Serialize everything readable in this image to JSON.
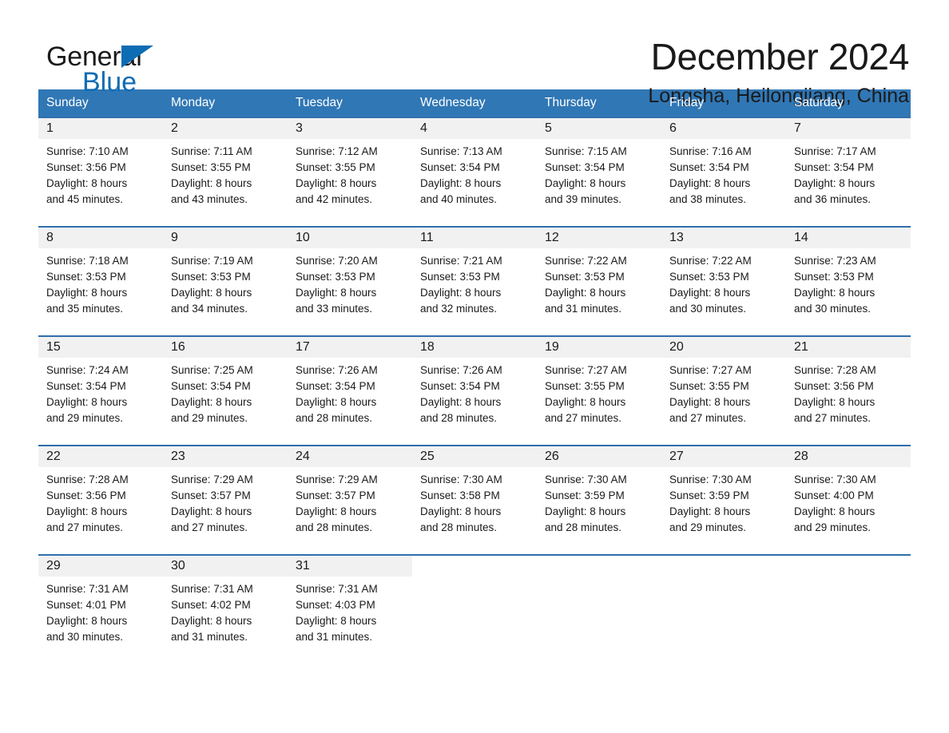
{
  "brand": {
    "name_part1": "General",
    "name_part2": "Blue",
    "triangle_color": "#0d6cb4"
  },
  "header": {
    "month_title": "December 2024",
    "location": "Longsha, Heilongjiang, China"
  },
  "calendar": {
    "accent_color": "#3077b5",
    "row_border_color": "#2f6fad",
    "daynum_band_color": "#f1f1f1",
    "weekday_headers": [
      "Sunday",
      "Monday",
      "Tuesday",
      "Wednesday",
      "Thursday",
      "Friday",
      "Saturday"
    ],
    "weeks": [
      [
        {
          "day": "1",
          "sunrise": "Sunrise: 7:10 AM",
          "sunset": "Sunset: 3:56 PM",
          "daylight_line1": "Daylight: 8 hours",
          "daylight_line2": "and 45 minutes."
        },
        {
          "day": "2",
          "sunrise": "Sunrise: 7:11 AM",
          "sunset": "Sunset: 3:55 PM",
          "daylight_line1": "Daylight: 8 hours",
          "daylight_line2": "and 43 minutes."
        },
        {
          "day": "3",
          "sunrise": "Sunrise: 7:12 AM",
          "sunset": "Sunset: 3:55 PM",
          "daylight_line1": "Daylight: 8 hours",
          "daylight_line2": "and 42 minutes."
        },
        {
          "day": "4",
          "sunrise": "Sunrise: 7:13 AM",
          "sunset": "Sunset: 3:54 PM",
          "daylight_line1": "Daylight: 8 hours",
          "daylight_line2": "and 40 minutes."
        },
        {
          "day": "5",
          "sunrise": "Sunrise: 7:15 AM",
          "sunset": "Sunset: 3:54 PM",
          "daylight_line1": "Daylight: 8 hours",
          "daylight_line2": "and 39 minutes."
        },
        {
          "day": "6",
          "sunrise": "Sunrise: 7:16 AM",
          "sunset": "Sunset: 3:54 PM",
          "daylight_line1": "Daylight: 8 hours",
          "daylight_line2": "and 38 minutes."
        },
        {
          "day": "7",
          "sunrise": "Sunrise: 7:17 AM",
          "sunset": "Sunset: 3:54 PM",
          "daylight_line1": "Daylight: 8 hours",
          "daylight_line2": "and 36 minutes."
        }
      ],
      [
        {
          "day": "8",
          "sunrise": "Sunrise: 7:18 AM",
          "sunset": "Sunset: 3:53 PM",
          "daylight_line1": "Daylight: 8 hours",
          "daylight_line2": "and 35 minutes."
        },
        {
          "day": "9",
          "sunrise": "Sunrise: 7:19 AM",
          "sunset": "Sunset: 3:53 PM",
          "daylight_line1": "Daylight: 8 hours",
          "daylight_line2": "and 34 minutes."
        },
        {
          "day": "10",
          "sunrise": "Sunrise: 7:20 AM",
          "sunset": "Sunset: 3:53 PM",
          "daylight_line1": "Daylight: 8 hours",
          "daylight_line2": "and 33 minutes."
        },
        {
          "day": "11",
          "sunrise": "Sunrise: 7:21 AM",
          "sunset": "Sunset: 3:53 PM",
          "daylight_line1": "Daylight: 8 hours",
          "daylight_line2": "and 32 minutes."
        },
        {
          "day": "12",
          "sunrise": "Sunrise: 7:22 AM",
          "sunset": "Sunset: 3:53 PM",
          "daylight_line1": "Daylight: 8 hours",
          "daylight_line2": "and 31 minutes."
        },
        {
          "day": "13",
          "sunrise": "Sunrise: 7:22 AM",
          "sunset": "Sunset: 3:53 PM",
          "daylight_line1": "Daylight: 8 hours",
          "daylight_line2": "and 30 minutes."
        },
        {
          "day": "14",
          "sunrise": "Sunrise: 7:23 AM",
          "sunset": "Sunset: 3:53 PM",
          "daylight_line1": "Daylight: 8 hours",
          "daylight_line2": "and 30 minutes."
        }
      ],
      [
        {
          "day": "15",
          "sunrise": "Sunrise: 7:24 AM",
          "sunset": "Sunset: 3:54 PM",
          "daylight_line1": "Daylight: 8 hours",
          "daylight_line2": "and 29 minutes."
        },
        {
          "day": "16",
          "sunrise": "Sunrise: 7:25 AM",
          "sunset": "Sunset: 3:54 PM",
          "daylight_line1": "Daylight: 8 hours",
          "daylight_line2": "and 29 minutes."
        },
        {
          "day": "17",
          "sunrise": "Sunrise: 7:26 AM",
          "sunset": "Sunset: 3:54 PM",
          "daylight_line1": "Daylight: 8 hours",
          "daylight_line2": "and 28 minutes."
        },
        {
          "day": "18",
          "sunrise": "Sunrise: 7:26 AM",
          "sunset": "Sunset: 3:54 PM",
          "daylight_line1": "Daylight: 8 hours",
          "daylight_line2": "and 28 minutes."
        },
        {
          "day": "19",
          "sunrise": "Sunrise: 7:27 AM",
          "sunset": "Sunset: 3:55 PM",
          "daylight_line1": "Daylight: 8 hours",
          "daylight_line2": "and 27 minutes."
        },
        {
          "day": "20",
          "sunrise": "Sunrise: 7:27 AM",
          "sunset": "Sunset: 3:55 PM",
          "daylight_line1": "Daylight: 8 hours",
          "daylight_line2": "and 27 minutes."
        },
        {
          "day": "21",
          "sunrise": "Sunrise: 7:28 AM",
          "sunset": "Sunset: 3:56 PM",
          "daylight_line1": "Daylight: 8 hours",
          "daylight_line2": "and 27 minutes."
        }
      ],
      [
        {
          "day": "22",
          "sunrise": "Sunrise: 7:28 AM",
          "sunset": "Sunset: 3:56 PM",
          "daylight_line1": "Daylight: 8 hours",
          "daylight_line2": "and 27 minutes."
        },
        {
          "day": "23",
          "sunrise": "Sunrise: 7:29 AM",
          "sunset": "Sunset: 3:57 PM",
          "daylight_line1": "Daylight: 8 hours",
          "daylight_line2": "and 27 minutes."
        },
        {
          "day": "24",
          "sunrise": "Sunrise: 7:29 AM",
          "sunset": "Sunset: 3:57 PM",
          "daylight_line1": "Daylight: 8 hours",
          "daylight_line2": "and 28 minutes."
        },
        {
          "day": "25",
          "sunrise": "Sunrise: 7:30 AM",
          "sunset": "Sunset: 3:58 PM",
          "daylight_line1": "Daylight: 8 hours",
          "daylight_line2": "and 28 minutes."
        },
        {
          "day": "26",
          "sunrise": "Sunrise: 7:30 AM",
          "sunset": "Sunset: 3:59 PM",
          "daylight_line1": "Daylight: 8 hours",
          "daylight_line2": "and 28 minutes."
        },
        {
          "day": "27",
          "sunrise": "Sunrise: 7:30 AM",
          "sunset": "Sunset: 3:59 PM",
          "daylight_line1": "Daylight: 8 hours",
          "daylight_line2": "and 29 minutes."
        },
        {
          "day": "28",
          "sunrise": "Sunrise: 7:30 AM",
          "sunset": "Sunset: 4:00 PM",
          "daylight_line1": "Daylight: 8 hours",
          "daylight_line2": "and 29 minutes."
        }
      ],
      [
        {
          "day": "29",
          "sunrise": "Sunrise: 7:31 AM",
          "sunset": "Sunset: 4:01 PM",
          "daylight_line1": "Daylight: 8 hours",
          "daylight_line2": "and 30 minutes."
        },
        {
          "day": "30",
          "sunrise": "Sunrise: 7:31 AM",
          "sunset": "Sunset: 4:02 PM",
          "daylight_line1": "Daylight: 8 hours",
          "daylight_line2": "and 31 minutes."
        },
        {
          "day": "31",
          "sunrise": "Sunrise: 7:31 AM",
          "sunset": "Sunset: 4:03 PM",
          "daylight_line1": "Daylight: 8 hours",
          "daylight_line2": "and 31 minutes."
        },
        {
          "day": "",
          "sunrise": "",
          "sunset": "",
          "daylight_line1": "",
          "daylight_line2": ""
        },
        {
          "day": "",
          "sunrise": "",
          "sunset": "",
          "daylight_line1": "",
          "daylight_line2": ""
        },
        {
          "day": "",
          "sunrise": "",
          "sunset": "",
          "daylight_line1": "",
          "daylight_line2": ""
        },
        {
          "day": "",
          "sunrise": "",
          "sunset": "",
          "daylight_line1": "",
          "daylight_line2": ""
        }
      ]
    ]
  }
}
